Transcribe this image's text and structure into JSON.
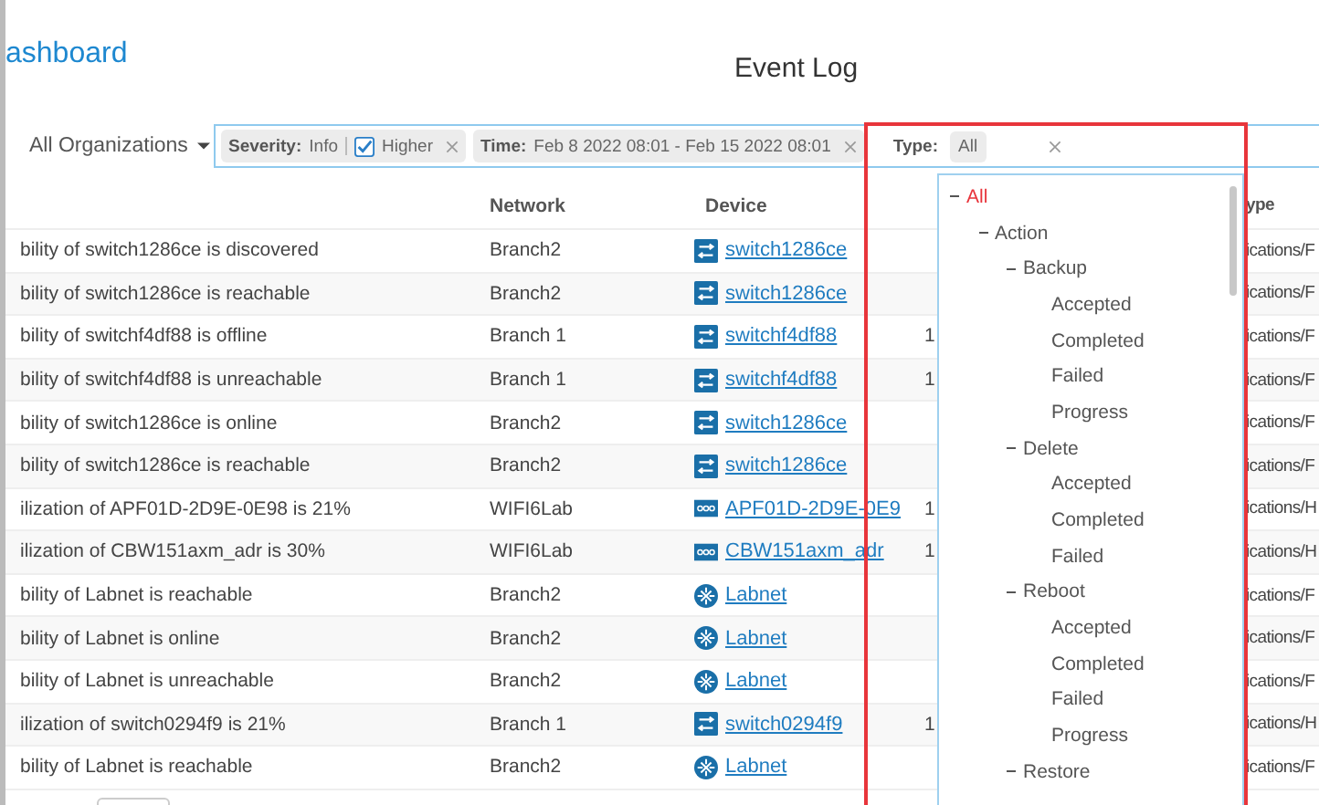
{
  "header": {
    "app_title": "ashboard",
    "page_title": "Event Log"
  },
  "filters": {
    "organization": "All Organizations",
    "severity": {
      "label": "Severity:",
      "value": "Info",
      "higher": {
        "label": "Higher",
        "checked": true
      }
    },
    "time": {
      "label": "Time:",
      "value": "Feb 8 2022 08:01 - Feb 15 2022 08:01"
    },
    "type": {
      "label": "Type:",
      "chip": "All"
    }
  },
  "table": {
    "columns": [
      "",
      "Network",
      "Device",
      "",
      "ype"
    ],
    "rows": [
      {
        "message": "bility of switch1286ce is discovered",
        "network": "Branch2",
        "device": {
          "name": "switch1286ce",
          "kind": "switch"
        },
        "column_4": "",
        "type": "ications/F"
      },
      {
        "message": "bility of switch1286ce is reachable",
        "network": "Branch2",
        "device": {
          "name": "switch1286ce",
          "kind": "switch"
        },
        "column_4": "",
        "type": "ications/F"
      },
      {
        "message": "bility of switchf4df88 is offline",
        "network": "Branch 1",
        "device": {
          "name": "switchf4df88",
          "kind": "switch"
        },
        "column_4": "1",
        "type": "ications/F"
      },
      {
        "message": "bility of switchf4df88 is unreachable",
        "network": "Branch 1",
        "device": {
          "name": "switchf4df88",
          "kind": "switch"
        },
        "column_4": "1",
        "type": "ications/F"
      },
      {
        "message": "bility of switch1286ce is online",
        "network": "Branch2",
        "device": {
          "name": "switch1286ce",
          "kind": "switch"
        },
        "column_4": "",
        "type": "ications/F"
      },
      {
        "message": "bility of switch1286ce is reachable",
        "network": "Branch2",
        "device": {
          "name": "switch1286ce",
          "kind": "switch"
        },
        "column_4": "",
        "type": "ications/F"
      },
      {
        "message": "ilization of APF01D-2D9E-0E98 is 21%",
        "network": "WIFI6Lab",
        "device": {
          "name": "APF01D-2D9E-0E9",
          "kind": "ap"
        },
        "column_4": "1",
        "type": "ications/H"
      },
      {
        "message": "ilization of CBW151axm_adr is 30%",
        "network": "WIFI6Lab",
        "device": {
          "name": "CBW151axm_adr",
          "kind": "ap"
        },
        "column_4": "1",
        "type": "ications/H"
      },
      {
        "message": "bility of Labnet is reachable",
        "network": "Branch2",
        "device": {
          "name": "Labnet",
          "kind": "network"
        },
        "column_4": "",
        "type": "ications/F"
      },
      {
        "message": "bility of Labnet is online",
        "network": "Branch2",
        "device": {
          "name": "Labnet",
          "kind": "network"
        },
        "column_4": "",
        "type": "ications/F"
      },
      {
        "message": "bility of Labnet is unreachable",
        "network": "Branch2",
        "device": {
          "name": "Labnet",
          "kind": "network"
        },
        "column_4": "",
        "type": "ications/F"
      },
      {
        "message": "ilization of switch0294f9 is 21%",
        "network": "Branch 1",
        "device": {
          "name": "switch0294f9",
          "kind": "switch"
        },
        "column_4": "1",
        "type": "ications/H"
      },
      {
        "message": "bility of Labnet is reachable",
        "network": "Branch2",
        "device": {
          "name": "Labnet",
          "kind": "network"
        },
        "column_4": "",
        "type": "ications/F"
      }
    ]
  },
  "type_dropdown": {
    "tree": [
      {
        "label": "All",
        "selected": true,
        "expanded": true,
        "children": [
          {
            "label": "Action",
            "selected": false,
            "expanded": true,
            "children": [
              {
                "label": "Backup",
                "selected": false,
                "expanded": true,
                "children": [
                  {
                    "label": "Accepted",
                    "selected": false
                  },
                  {
                    "label": "Completed",
                    "selected": false
                  },
                  {
                    "label": "Failed",
                    "selected": false
                  },
                  {
                    "label": "Progress",
                    "selected": false
                  }
                ]
              },
              {
                "label": "Delete",
                "selected": false,
                "expanded": true,
                "children": [
                  {
                    "label": "Accepted",
                    "selected": false
                  },
                  {
                    "label": "Completed",
                    "selected": false
                  },
                  {
                    "label": "Failed",
                    "selected": false
                  }
                ]
              },
              {
                "label": "Reboot",
                "selected": false,
                "expanded": true,
                "children": [
                  {
                    "label": "Accepted",
                    "selected": false
                  },
                  {
                    "label": "Completed",
                    "selected": false
                  },
                  {
                    "label": "Failed",
                    "selected": false
                  },
                  {
                    "label": "Progress",
                    "selected": false
                  }
                ]
              },
              {
                "label": "Restore",
                "selected": false,
                "expanded": true
              }
            ]
          }
        ]
      }
    ]
  }
}
